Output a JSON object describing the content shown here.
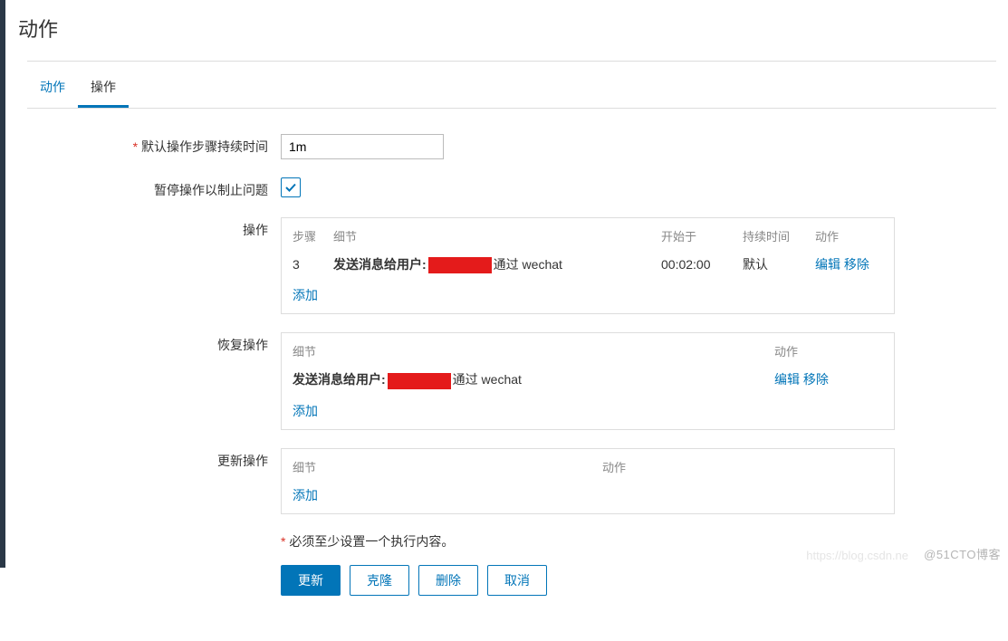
{
  "page_title": "动作",
  "tabs": [
    "动作",
    "操作"
  ],
  "active_tab_index": 1,
  "form": {
    "duration_label": "默认操作步骤持续时间",
    "duration_value": "1m",
    "pause_label": "暂停操作以制止问题",
    "pause_checked": true
  },
  "operations": {
    "label": "操作",
    "headers": {
      "step": "步骤",
      "detail": "细节",
      "start": "开始于",
      "duration": "持续时间",
      "action": "动作"
    },
    "row": {
      "step": "3",
      "detail_prefix": "发送消息给用户:",
      "detail_suffix": "通过 wechat",
      "start": "00:02:00",
      "duration": "默认",
      "edit": "编辑",
      "remove": "移除"
    },
    "add": "添加"
  },
  "recovery": {
    "label": "恢复操作",
    "headers": {
      "detail": "细节",
      "action": "动作"
    },
    "row": {
      "detail_prefix": "发送消息给用户:",
      "detail_suffix": "通过 wechat",
      "edit": "编辑",
      "remove": "移除"
    },
    "add": "添加"
  },
  "update": {
    "label": "更新操作",
    "headers": {
      "detail": "细节",
      "action": "动作"
    },
    "add": "添加"
  },
  "footer": {
    "msg": "必须至少设置一个执行内容。",
    "submit": "更新",
    "clone": "克隆",
    "delete": "删除",
    "cancel": "取消"
  },
  "watermark": "@51CTO博客",
  "watermark2": "https://blog.csdn.ne"
}
